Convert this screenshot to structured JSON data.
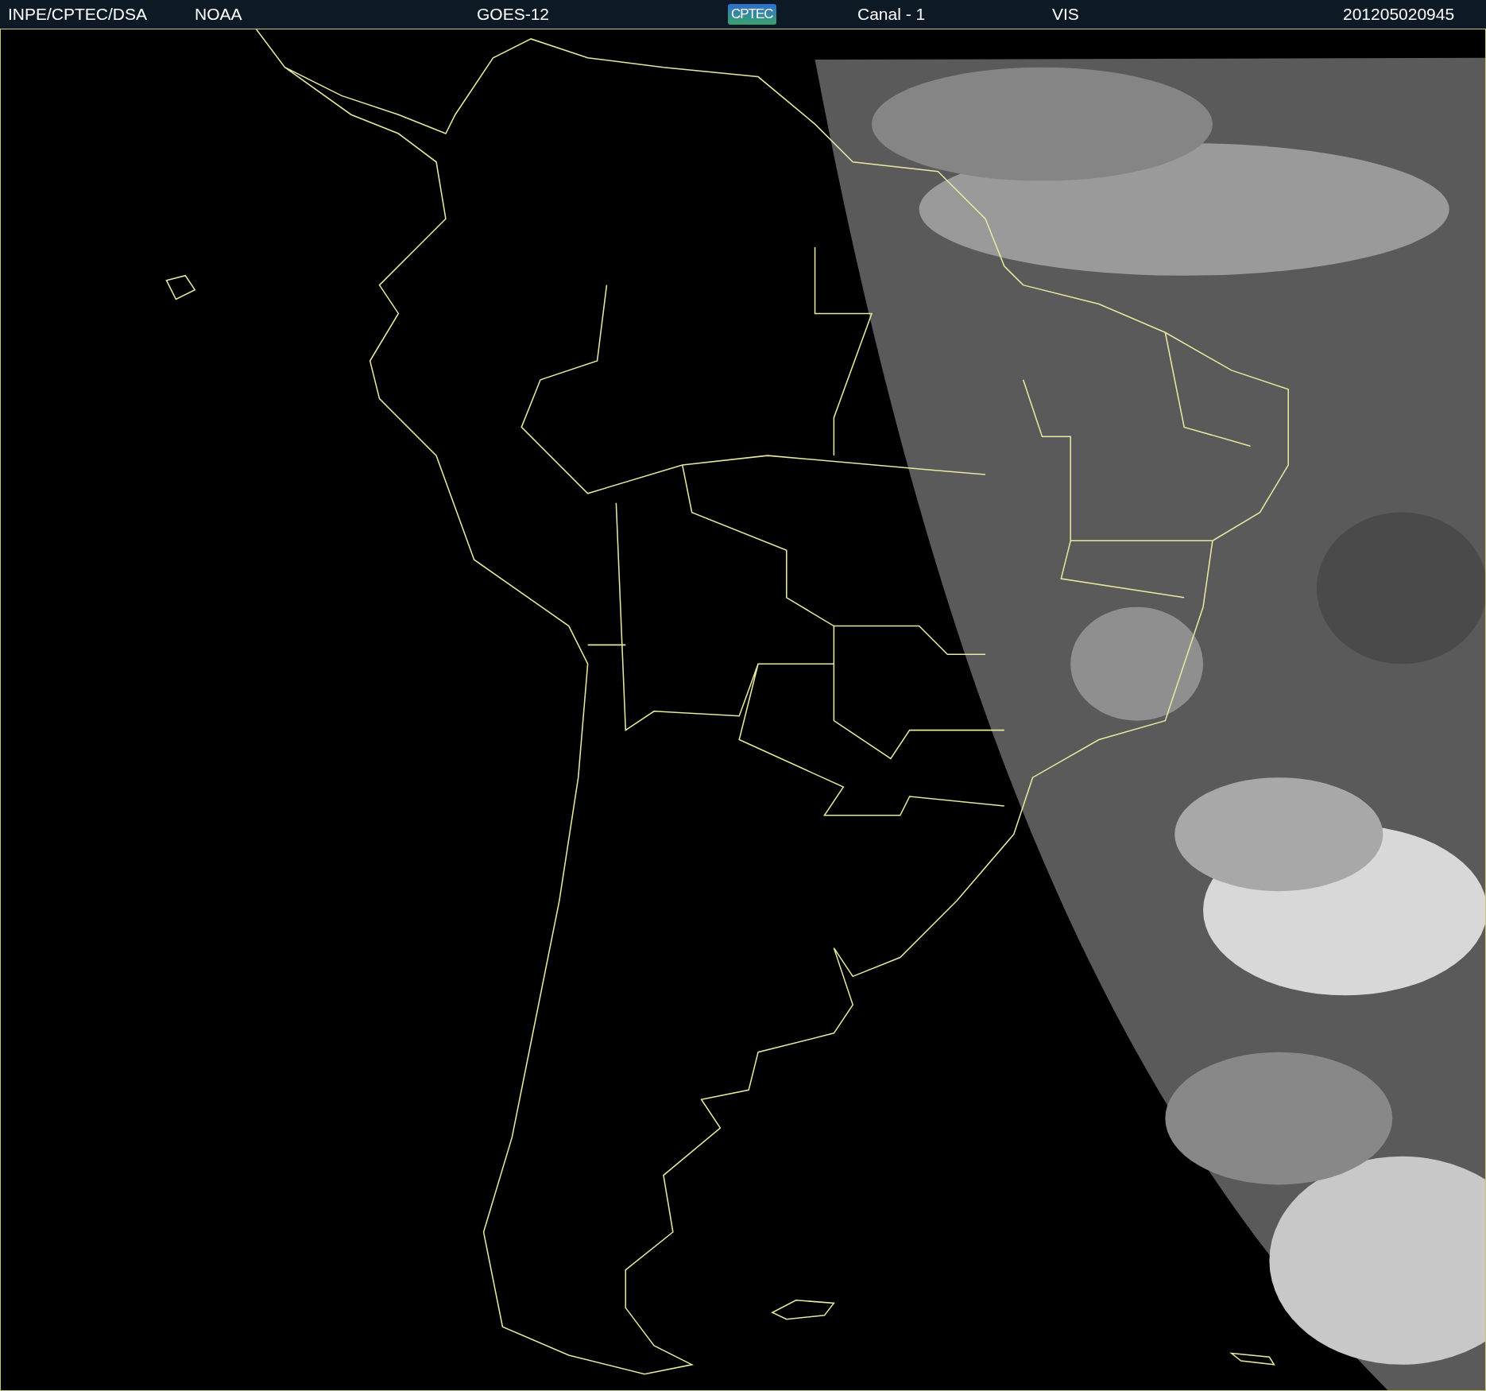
{
  "header": {
    "items": [
      {
        "kind": "text",
        "text": "INPE/CPTEC/DSA"
      },
      {
        "kind": "text",
        "text": "NOAA"
      },
      {
        "kind": "text",
        "text": "GOES-12"
      },
      {
        "kind": "logo",
        "text": "CPTEC"
      },
      {
        "kind": "text",
        "text": "Canal - 1"
      },
      {
        "kind": "text",
        "text": "VIS"
      },
      {
        "kind": "text",
        "text": "201205020945"
      }
    ]
  }
}
